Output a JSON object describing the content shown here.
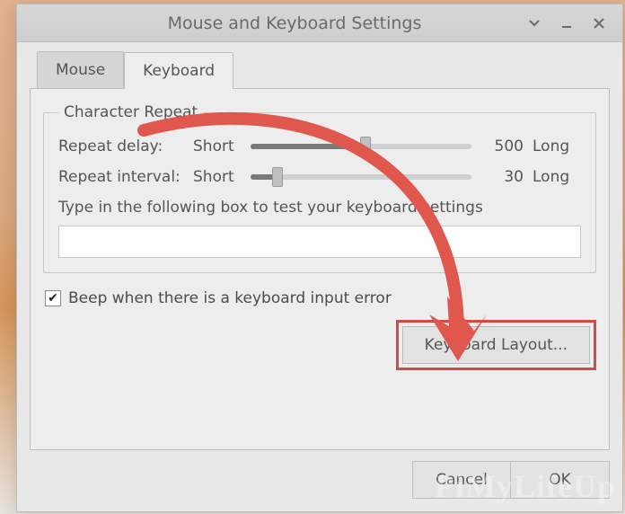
{
  "title": "Mouse and Keyboard Settings",
  "tabs": {
    "mouse": "Mouse",
    "keyboard": "Keyboard"
  },
  "group": {
    "legend": "Character Repeat",
    "delay": {
      "label": "Repeat delay:",
      "short": "Short",
      "long": "Long",
      "value": "500",
      "fill_pct": 52
    },
    "interval": {
      "label": "Repeat interval:",
      "short": "Short",
      "long": "Long",
      "value": "30",
      "fill_pct": 12
    },
    "help": "Type in the following box to test your keyboard settings"
  },
  "beep": {
    "checked": true,
    "label": "Beep when there is a keyboard input error"
  },
  "buttons": {
    "keyboard_layout": "Keyboard Layout...",
    "cancel": "Cancel",
    "ok": "OK"
  },
  "watermark": "PiMyLifeUp"
}
